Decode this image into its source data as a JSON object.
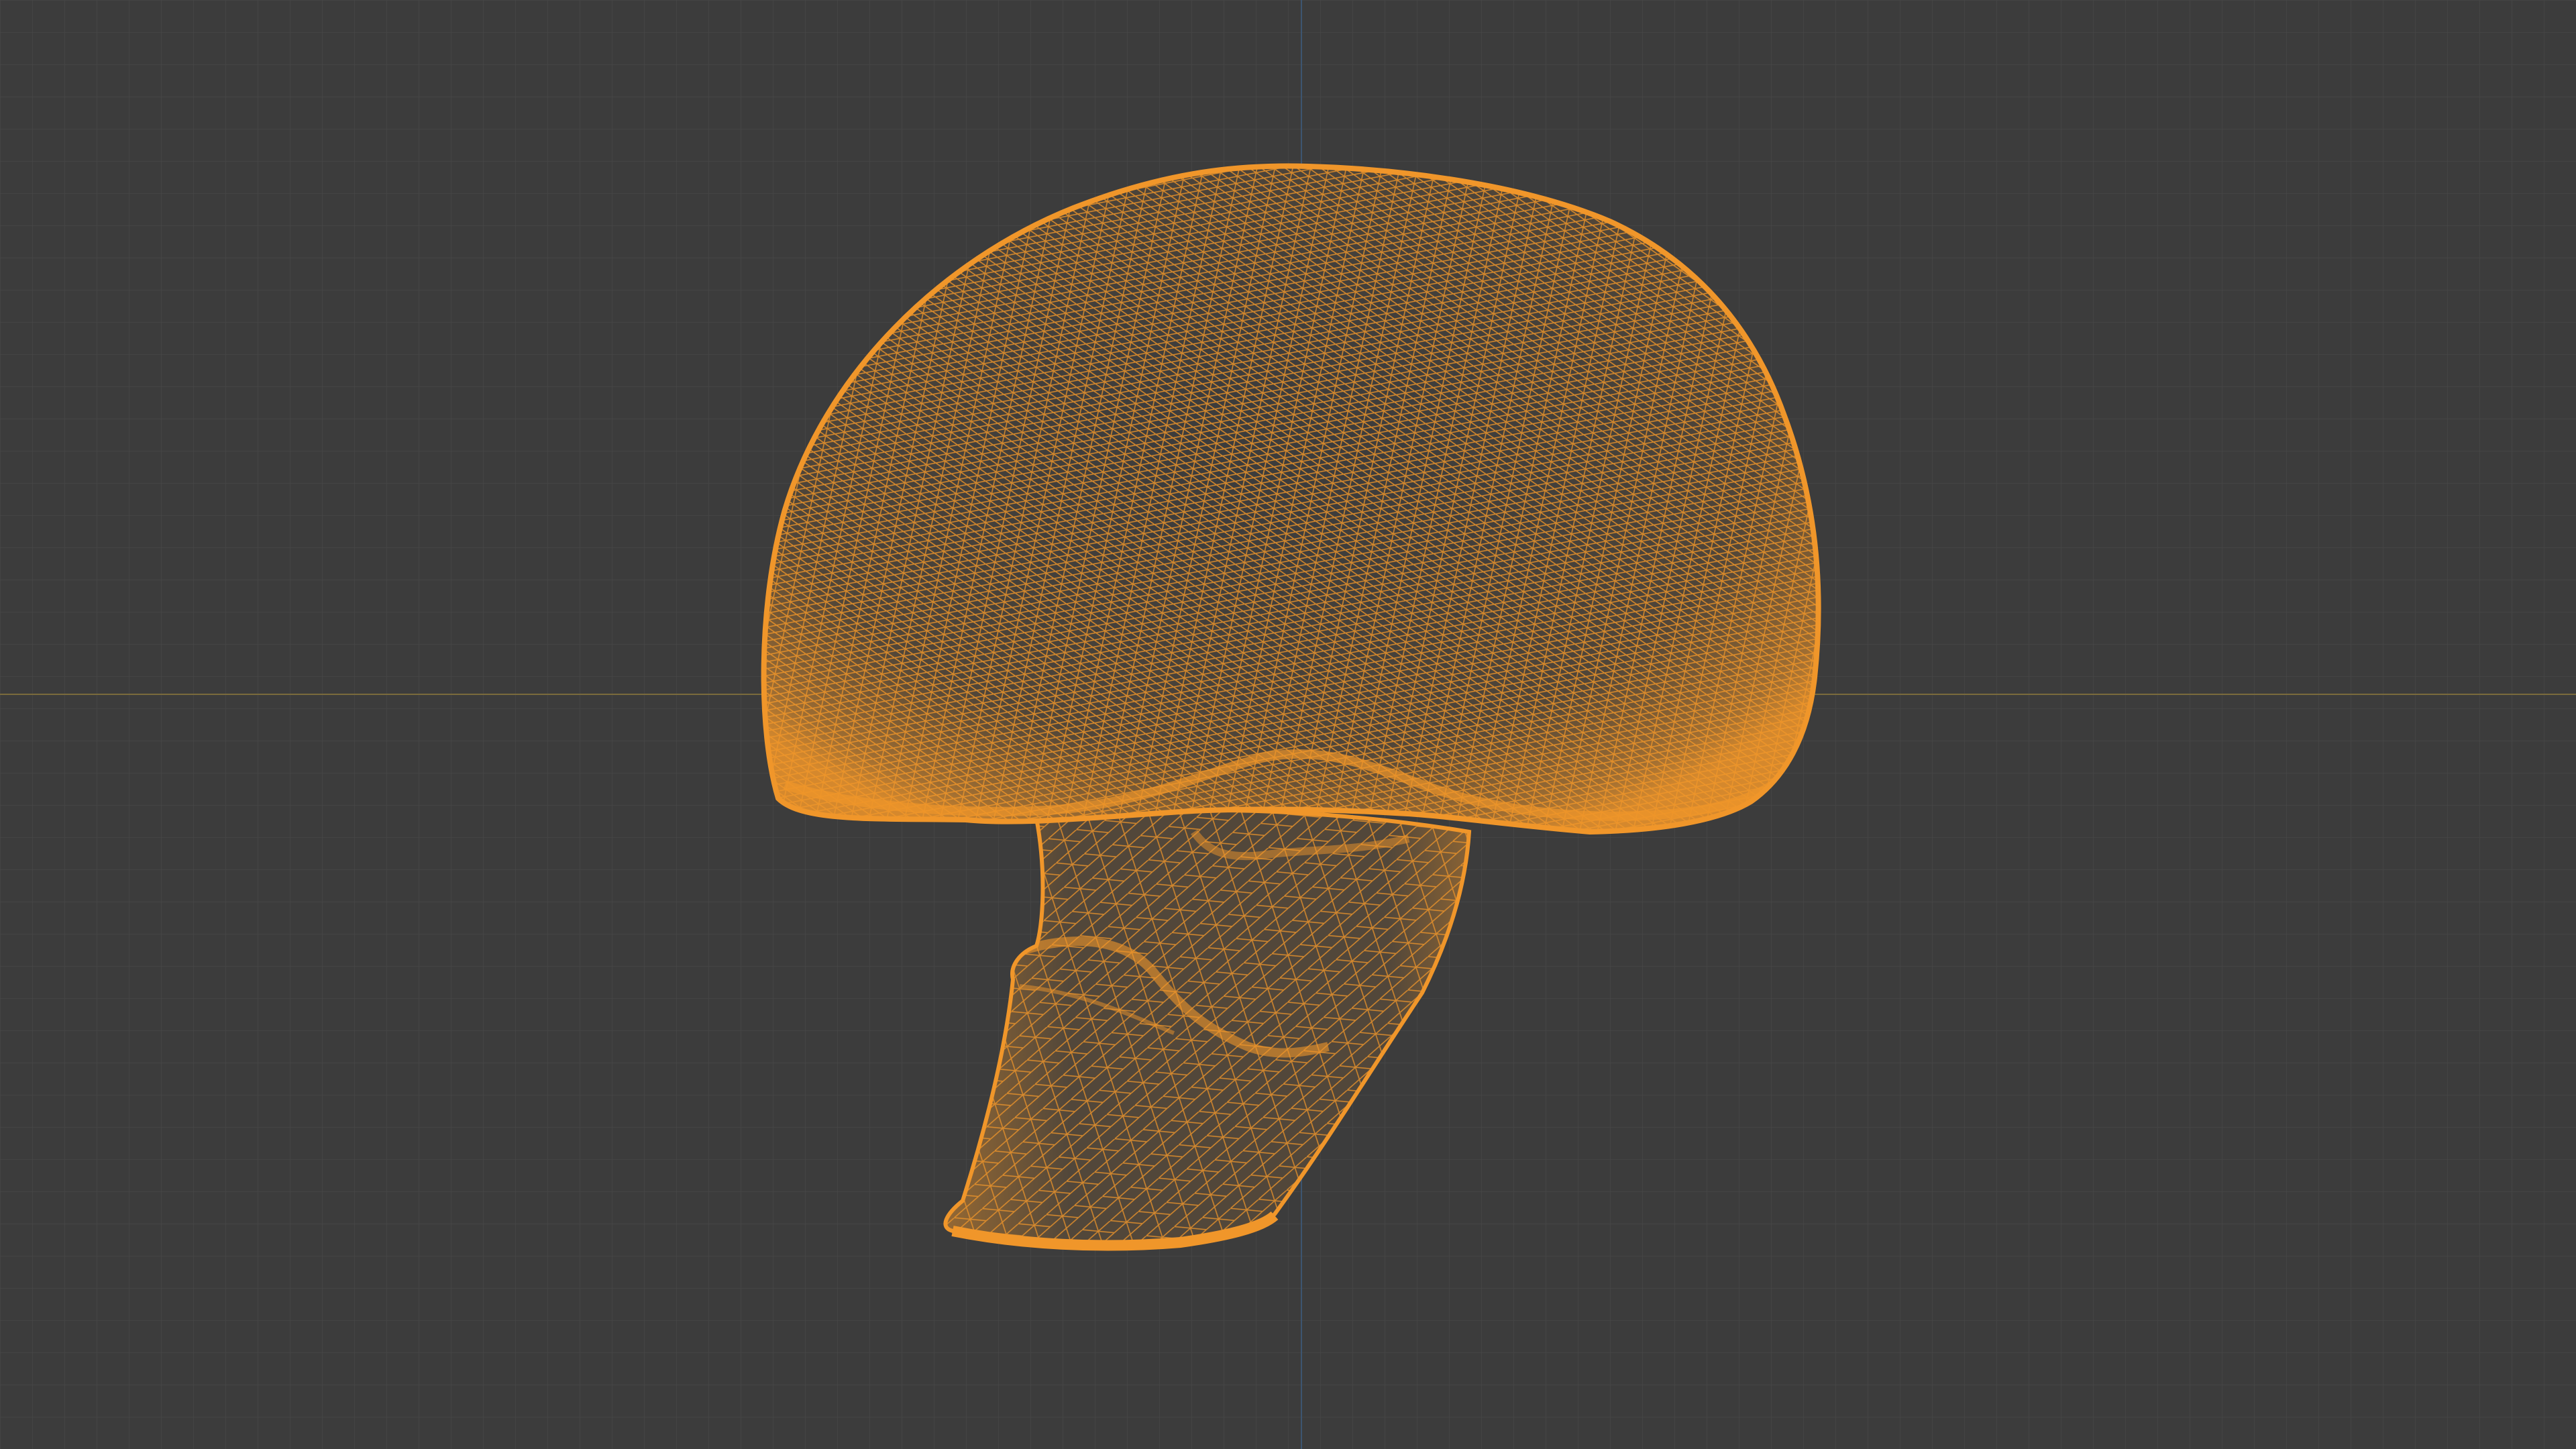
{
  "viewport": {
    "background_color": "#3c3c3c",
    "grid_minor_color": "#444444",
    "grid_major_color": "#4a4a4a",
    "axis_x_color": "#7a6a3c",
    "axis_y_color": "#3d5570",
    "wire_color": "#f0962a",
    "wire_glow_color": "#e08a22"
  },
  "object": {
    "name": "mushroom",
    "display_mode": "wireframe",
    "selected": true
  }
}
